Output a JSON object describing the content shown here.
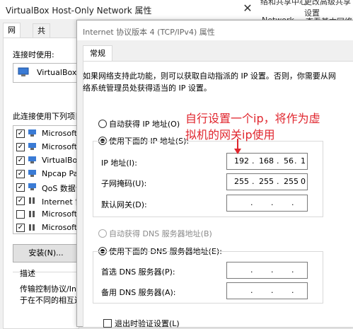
{
  "background_window": {
    "title": "VirtualBox Host-Only Network 属性",
    "close_glyph": "✕",
    "right_hints": [
      "络和共享中心",
      "更改高级共享设置",
      "Network",
      "查看基本网络信息"
    ],
    "tabs": [
      "网络",
      "共享"
    ],
    "connect_using_label": "连接时使用:",
    "adapter_name": "VirtualBox H",
    "items_label": "此连接使用下列项目",
    "items": [
      {
        "label": "Microsoft",
        "checked": true,
        "icon": "network-client-icon"
      },
      {
        "label": "Microsoft",
        "checked": true,
        "icon": "network-client-icon"
      },
      {
        "label": "VirtualBox",
        "checked": true,
        "icon": "network-client-icon"
      },
      {
        "label": "Npcap Pac",
        "checked": true,
        "icon": "network-client-icon"
      },
      {
        "label": "QoS 数据包",
        "checked": true,
        "icon": "network-client-icon"
      },
      {
        "label": "Internet 协",
        "checked": true,
        "icon": "protocol-icon"
      },
      {
        "label": "Microsoft",
        "checked": false,
        "icon": "protocol-icon"
      },
      {
        "label": "Microsoft",
        "checked": true,
        "icon": "protocol-icon"
      }
    ],
    "install_button": "安装(N)...",
    "description_label": "描述",
    "description_lines": [
      "传输控制协议/Inte",
      "于在不同的相互连"
    ]
  },
  "dialog": {
    "title": "Internet 协议版本 4 (TCP/IPv4) 属性",
    "tab": "常规",
    "intro_line1": "如果网络支持此功能，则可以获取自动指派的 IP 设置。否则，你需要从网",
    "intro_line2": "络系统管理员处获得适当的 IP 设置。",
    "auto_ip_label": "自动获得 IP 地址(O)",
    "use_ip_label": "使用下面的 IP 地址(S):",
    "ip_label": "IP 地址(I):",
    "ip_value": [
      "192",
      "168",
      "56",
      "1"
    ],
    "mask_label": "子网掩码(U):",
    "mask_value": [
      "255",
      "255",
      "255",
      "0"
    ],
    "gateway_label": "默认网关(D):",
    "gateway_value": [
      "",
      "",
      "",
      ""
    ],
    "auto_dns_label": "自动获得 DNS 服务器地址(B)",
    "use_dns_label": "使用下面的 DNS 服务器地址(E):",
    "preferred_dns_label": "首选 DNS 服务器(P):",
    "alternate_dns_label": "备用 DNS 服务器(A):",
    "validate_on_exit_label": "退出时验证设置(L)"
  },
  "annotation": {
    "text_line1": "自行设置一个ip，将作为虚",
    "text_line2": "拟机的网关ip使用",
    "color": "#e0262e"
  }
}
